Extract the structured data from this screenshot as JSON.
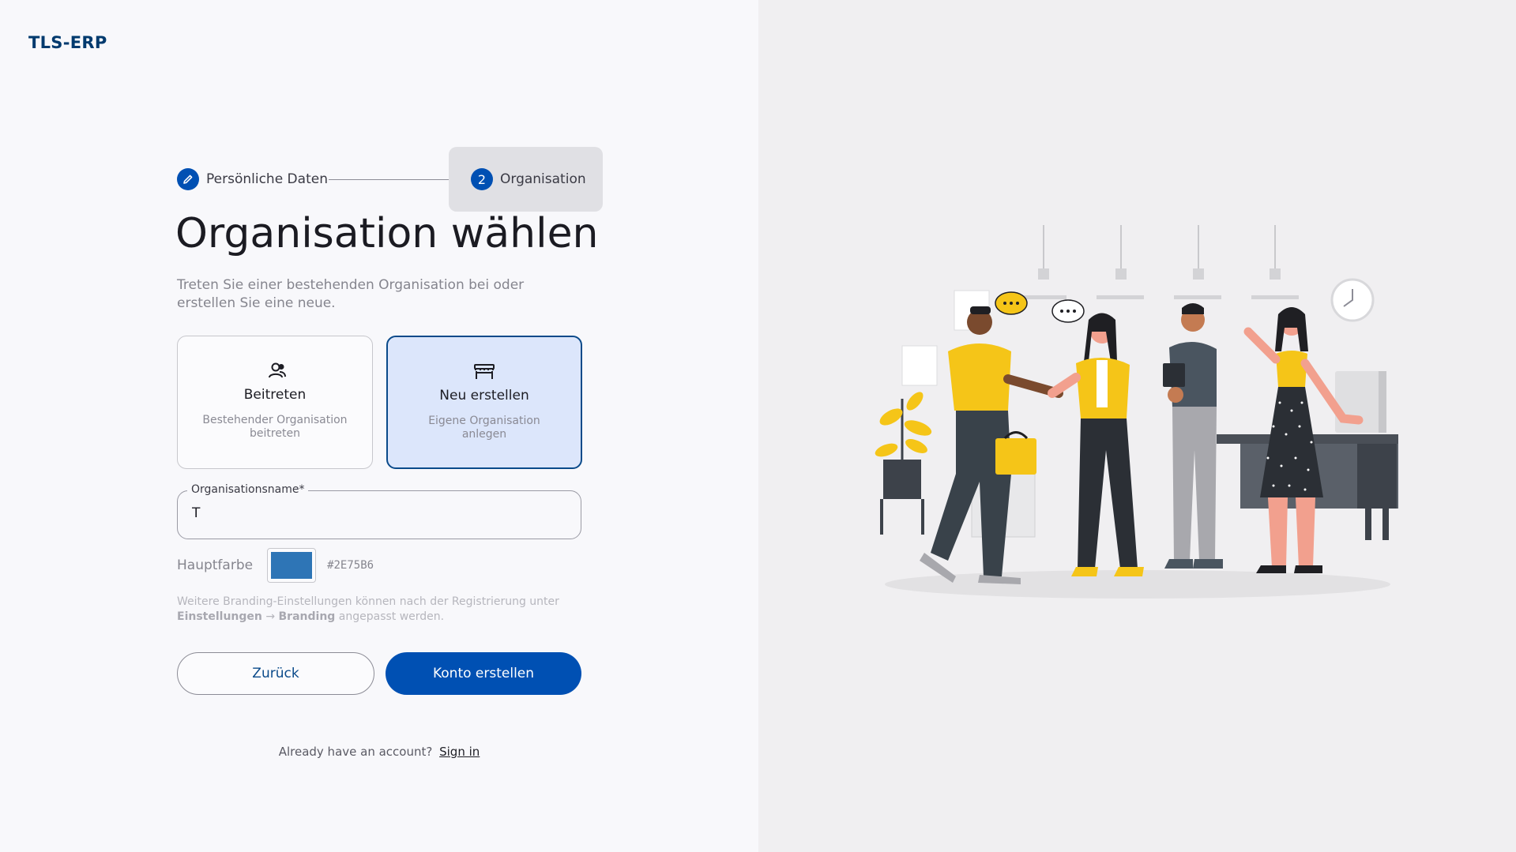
{
  "brand": {
    "logo": "TLS-ERP",
    "primary_color": "#0050b3",
    "dark_color": "#003a6e"
  },
  "stepper": {
    "step1": {
      "label": "Persönliche Daten",
      "icon": "pencil-icon",
      "state": "completed"
    },
    "step2": {
      "number": "2",
      "label": "Organisation",
      "state": "active"
    }
  },
  "heading": {
    "title": "Organisation wählen",
    "subtitle": "Treten Sie einer bestehenden Organisation bei oder erstellen Sie eine neue."
  },
  "options": {
    "join": {
      "title": "Beitreten",
      "description": "Bestehender Organisation beitreten",
      "icon": "users-icon",
      "selected": false
    },
    "create": {
      "title": "Neu erstellen",
      "description": "Eigene Organisation anlegen",
      "icon": "storefront-icon",
      "selected": true
    }
  },
  "form": {
    "org_name": {
      "label": "Organisationsname*",
      "value": "T"
    },
    "primary_color": {
      "label": "Hauptfarbe",
      "value": "#2E75B6"
    }
  },
  "hint": {
    "prefix": "Weitere Branding-Einstellungen können nach der Registrierung unter",
    "path_a": "Einstellungen",
    "arrow": "→",
    "path_b": "Branding",
    "suffix": "angepasst werden."
  },
  "buttons": {
    "back": "Zurück",
    "create": "Konto erstellen"
  },
  "signin": {
    "prompt": "Already have an account?",
    "link": "Sign in"
  },
  "illustration": {
    "name": "team-handshake-illustration",
    "accent": "#f5c518"
  }
}
